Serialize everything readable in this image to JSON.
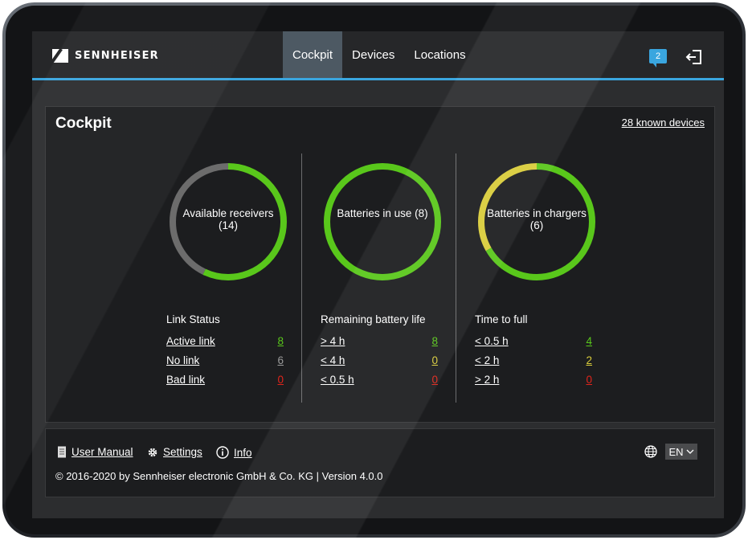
{
  "brand": "SENNHEISER",
  "nav": {
    "tabs": [
      "Cockpit",
      "Devices",
      "Locations"
    ],
    "active": "Cockpit"
  },
  "notifications": {
    "count": "2"
  },
  "cockpit": {
    "title": "Cockpit",
    "known_devices": "28 known devices",
    "columns": [
      {
        "ring_label": "Available receivers (14)",
        "segments": [
          {
            "fraction": 0.571,
            "color": "#59c71b"
          },
          {
            "fraction": 0.429,
            "color": "#6c6c6c"
          }
        ],
        "stat_title": "Link Status",
        "rows": [
          {
            "label": "Active link",
            "value": "8",
            "color": "#59c71b"
          },
          {
            "label": "No link",
            "value": "6",
            "color": "#9a9a9a"
          },
          {
            "label": "Bad link",
            "value": "0",
            "color": "#e0251b"
          }
        ]
      },
      {
        "ring_label": "Batteries in use (8)",
        "segments": [
          {
            "fraction": 1.0,
            "color": "#59c71b"
          }
        ],
        "stat_title": "Remaining battery life",
        "rows": [
          {
            "label": "> 4 h",
            "value": "8",
            "color": "#59c71b"
          },
          {
            "label": "< 4 h",
            "value": "0",
            "color": "#d9cc3a"
          },
          {
            "label": "< 0.5 h",
            "value": "0",
            "color": "#e0251b"
          }
        ]
      },
      {
        "ring_label": "Batteries in chargers (6)",
        "segments": [
          {
            "fraction": 0.667,
            "color": "#59c71b"
          },
          {
            "fraction": 0.333,
            "color": "#d9cc3a"
          }
        ],
        "stat_title": "Time to full",
        "rows": [
          {
            "label": "< 0.5 h",
            "value": "4",
            "color": "#59c71b"
          },
          {
            "label": "< 2 h",
            "value": "2",
            "color": "#d9cc3a"
          },
          {
            "label": "> 2 h",
            "value": "0",
            "color": "#e0251b"
          }
        ]
      }
    ]
  },
  "footer": {
    "user_manual": "User Manual",
    "settings": "Settings",
    "info": "Info",
    "copyright": "© 2016-2020 by Sennheiser electronic GmbH & Co. KG | Version 4.0.0",
    "language": "EN"
  },
  "icons": [
    "manual-icon",
    "gear-icon",
    "info-icon",
    "globe-icon",
    "chat-icon",
    "logout-icon",
    "chevron-down-icon"
  ]
}
